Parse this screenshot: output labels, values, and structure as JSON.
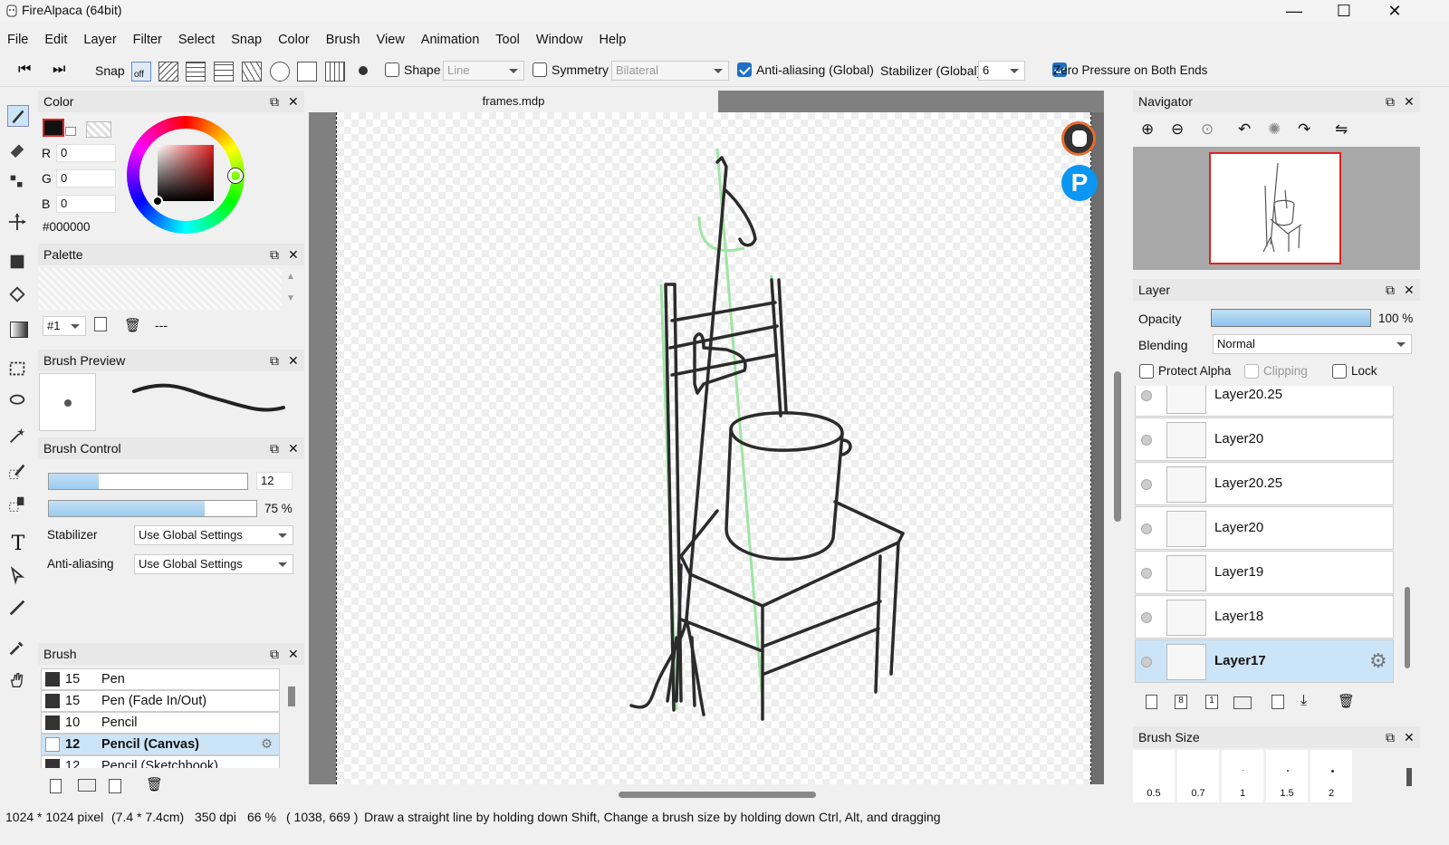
{
  "window": {
    "title": "FireAlpaca (64bit)"
  },
  "menu": [
    "File",
    "Edit",
    "Layer",
    "Filter",
    "Select",
    "Snap",
    "Color",
    "Brush",
    "View",
    "Animation",
    "Tool",
    "Window",
    "Help"
  ],
  "toolbar": {
    "snap_label": "Snap",
    "snap_off": "off",
    "shape_label": "Shape",
    "shape_value": "Line",
    "symmetry_label": "Symmetry",
    "symmetry_value": "Bilateral",
    "antialias_label": "Anti-aliasing (Global)",
    "stabilizer_label": "Stabilizer (Global)",
    "stabilizer_value": "6",
    "zero_pressure_label": "Zero Pressure on Both Ends"
  },
  "color_panel": {
    "title": "Color",
    "r_label": "R",
    "g_label": "G",
    "b_label": "B",
    "r": "0",
    "g": "0",
    "b": "0",
    "hex": "#000000"
  },
  "palette_panel": {
    "title": "Palette",
    "selector": "#1",
    "dashes": "---"
  },
  "brush_preview": {
    "title": "Brush Preview"
  },
  "brush_control": {
    "title": "Brush Control",
    "size": "12",
    "opacity": "75 %",
    "size_fill": 0.25,
    "opacity_fill": 0.75,
    "stabilizer_label": "Stabilizer",
    "stabilizer_value": "Use Global Settings",
    "antialias_label": "Anti-aliasing",
    "antialias_value": "Use Global Settings"
  },
  "brush_panel": {
    "title": "Brush",
    "items": [
      {
        "size": "15",
        "name": "Pen"
      },
      {
        "size": "15",
        "name": "Pen (Fade In/Out)"
      },
      {
        "size": "10",
        "name": "Pencil"
      },
      {
        "size": "12",
        "name": "Pencil (Canvas)"
      },
      {
        "size": "12",
        "name": "Pencil (Sketchbook)"
      }
    ]
  },
  "document": {
    "tab": "frames.mdp"
  },
  "navigator": {
    "title": "Navigator"
  },
  "layer_panel": {
    "title": "Layer",
    "opacity_label": "Opacity",
    "opacity_value": "100 %",
    "blending_label": "Blending",
    "blending_value": "Normal",
    "protect_alpha": "Protect Alpha",
    "clipping": "Clipping",
    "lock": "Lock",
    "layers": [
      "Layer20.25",
      "Layer20",
      "Layer20.25",
      "Layer20",
      "Layer19",
      "Layer18",
      "Layer17"
    ]
  },
  "brush_size_panel": {
    "title": "Brush Size",
    "sizes": [
      "0.5",
      "0.7",
      "1",
      "1.5",
      "2"
    ]
  },
  "status": {
    "dimensions": "1024 * 1024 pixel",
    "physical": "(7.4 * 7.4cm)",
    "dpi": "350 dpi",
    "zoom": "66 %",
    "coords": "( 1038, 669 )",
    "hint": "Draw a straight line by holding down Shift, Change a brush size by holding down Ctrl, Alt, and dragging"
  },
  "colors": {
    "accent": "#1f6fc5",
    "selection": "#cce4f7",
    "nav_frame": "#e02020"
  }
}
